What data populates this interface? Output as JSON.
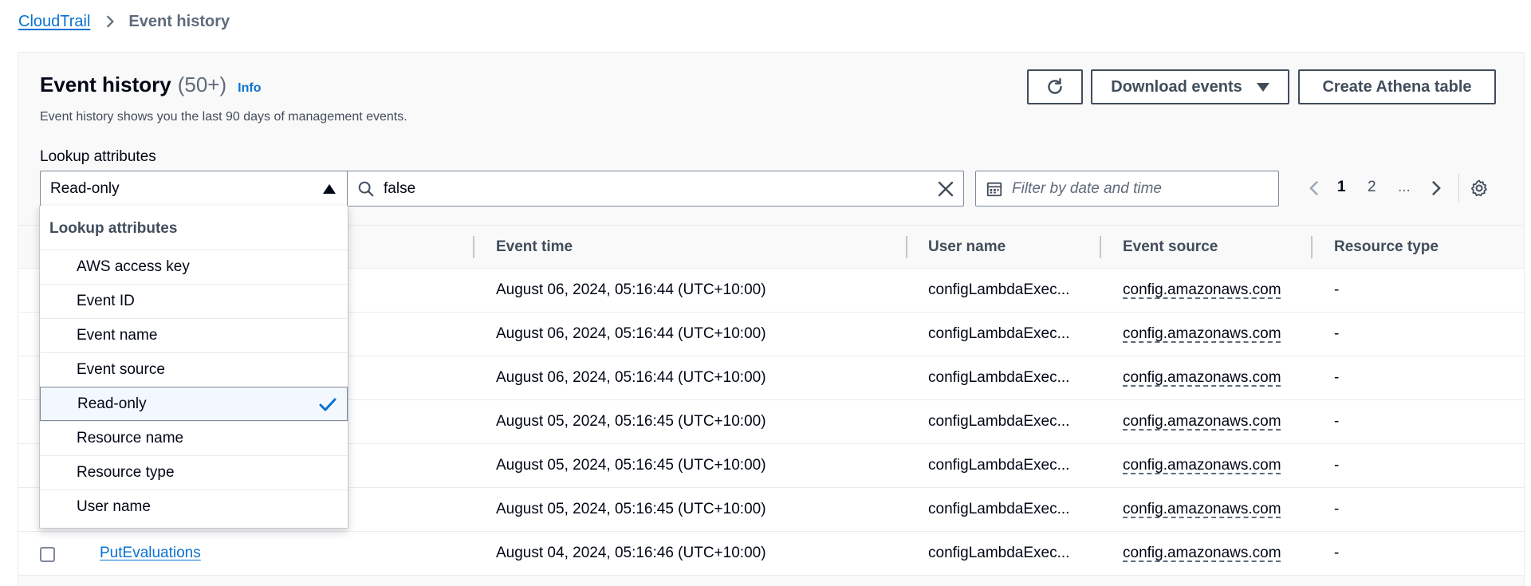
{
  "breadcrumb": {
    "root": "CloudTrail",
    "current": "Event history"
  },
  "header": {
    "title": "Event history",
    "count": "(50+)",
    "info": "Info",
    "description": "Event history shows you the last 90 days of management events."
  },
  "toolbar": {
    "download_label": "Download events",
    "athena_label": "Create Athena table"
  },
  "lookup": {
    "label": "Lookup attributes",
    "selected": "Read-only",
    "search_value": "false",
    "date_placeholder": "Filter by date and time"
  },
  "pagination": {
    "page1": "1",
    "page2": "2",
    "ellipsis": "..."
  },
  "table": {
    "headers": {
      "event_time": "Event time",
      "user_name": "User name",
      "event_source": "Event source",
      "resource_type": "Resource type"
    },
    "rows": [
      {
        "event_name": "",
        "event_time": "August 06, 2024, 05:16:44 (UTC+10:00)",
        "user_name": "configLambdaExec...",
        "event_source": "config.amazonaws.com",
        "resource_type": "-"
      },
      {
        "event_name": "",
        "event_time": "August 06, 2024, 05:16:44 (UTC+10:00)",
        "user_name": "configLambdaExec...",
        "event_source": "config.amazonaws.com",
        "resource_type": "-"
      },
      {
        "event_name": "",
        "event_time": "August 06, 2024, 05:16:44 (UTC+10:00)",
        "user_name": "configLambdaExec...",
        "event_source": "config.amazonaws.com",
        "resource_type": "-"
      },
      {
        "event_name": "",
        "event_time": "August 05, 2024, 05:16:45 (UTC+10:00)",
        "user_name": "configLambdaExec...",
        "event_source": "config.amazonaws.com",
        "resource_type": "-"
      },
      {
        "event_name": "",
        "event_time": "August 05, 2024, 05:16:45 (UTC+10:00)",
        "user_name": "configLambdaExec...",
        "event_source": "config.amazonaws.com",
        "resource_type": "-"
      },
      {
        "event_name": "",
        "event_time": "August 05, 2024, 05:16:45 (UTC+10:00)",
        "user_name": "configLambdaExec...",
        "event_source": "config.amazonaws.com",
        "resource_type": "-"
      },
      {
        "event_name": "PutEvaluations",
        "event_time": "August 04, 2024, 05:16:46 (UTC+10:00)",
        "user_name": "configLambdaExec...",
        "event_source": "config.amazonaws.com",
        "resource_type": "-"
      }
    ]
  },
  "dropdown": {
    "group_label": "Lookup attributes",
    "options": [
      {
        "label": "AWS access key",
        "selected": false
      },
      {
        "label": "Event ID",
        "selected": false
      },
      {
        "label": "Event name",
        "selected": false
      },
      {
        "label": "Event source",
        "selected": false
      },
      {
        "label": "Read-only",
        "selected": true
      },
      {
        "label": "Resource name",
        "selected": false
      },
      {
        "label": "Resource type",
        "selected": false
      },
      {
        "label": "User name",
        "selected": false
      }
    ]
  },
  "colors": {
    "link": "#0972d3",
    "text": "#000716",
    "muted": "#5f6b7a",
    "border": "#7d8998"
  },
  "icons": [
    "chevron-right-icon",
    "refresh-icon",
    "caret-down-icon",
    "caret-up-icon",
    "search-icon",
    "close-icon",
    "calendar-icon",
    "chevron-left-icon",
    "gear-icon",
    "check-icon"
  ]
}
